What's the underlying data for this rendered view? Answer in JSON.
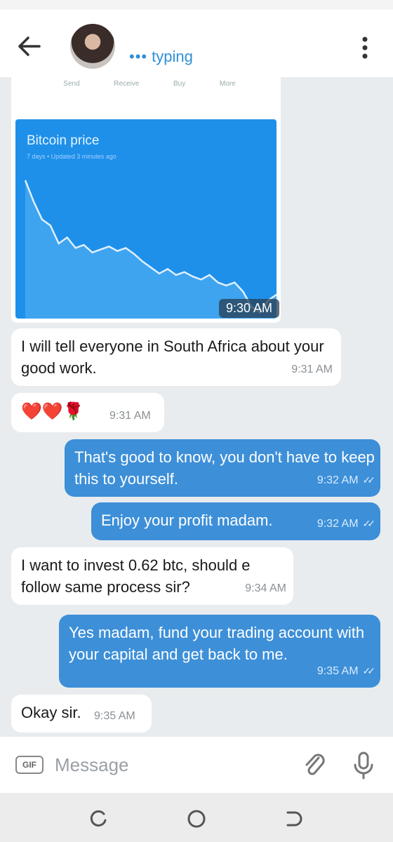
{
  "header": {
    "typing_dots": "•••",
    "status": "typing"
  },
  "image_message": {
    "tabs": [
      "Send",
      "Receive",
      "Buy",
      "More"
    ],
    "chart_title": "Bitcoin price",
    "chart_subtitle": "7 days • Updated 3 minutes ago",
    "time": "9:30 AM"
  },
  "chart_data": {
    "type": "area",
    "title": "Bitcoin price",
    "subtitle": "7 days • Updated 3 minutes ago",
    "x": [
      0,
      1,
      2,
      3,
      4,
      5,
      6,
      7,
      8,
      9,
      10,
      11,
      12,
      13,
      14,
      15,
      16,
      17,
      18,
      19,
      20,
      21,
      22,
      23,
      24,
      25,
      26,
      27,
      28,
      29,
      30
    ],
    "values": [
      92,
      78,
      66,
      62,
      50,
      54,
      47,
      49,
      44,
      46,
      48,
      45,
      47,
      43,
      38,
      34,
      30,
      33,
      29,
      31,
      28,
      26,
      29,
      24,
      22,
      24,
      18,
      8,
      4,
      12,
      16
    ],
    "grid": false
  },
  "messages": [
    {
      "dir": "in",
      "text": "I will tell everyone in South Africa about your good work.",
      "time": "9:31 AM"
    },
    {
      "dir": "in",
      "text": "❤️❤️🌹",
      "time": "9:31 AM"
    },
    {
      "dir": "out",
      "text": "That's good to know, you don't have to keep this to yourself.",
      "time": "9:32 AM"
    },
    {
      "dir": "out",
      "text": "Enjoy your profit madam.",
      "time": "9:32 AM"
    },
    {
      "dir": "in",
      "text": "I want to invest 0.62 btc, should e follow same process sir?",
      "time": "9:34 AM"
    },
    {
      "dir": "out",
      "text": "Yes madam, fund your trading account with your capital and get back to me.",
      "time": "9:35 AM"
    },
    {
      "dir": "in",
      "text": "Okay sir.",
      "time": "9:35 AM"
    }
  ],
  "input": {
    "gif_label": "GIF",
    "placeholder": "Message"
  },
  "icons": {
    "back": "arrow-left",
    "menu": "dots-vertical",
    "attach": "paperclip",
    "mic": "microphone",
    "nav_recent": "recent-apps",
    "nav_home": "home",
    "nav_back": "back"
  },
  "colors": {
    "accent": "#2f8fd8",
    "outgoing_bubble": "#3d8fd8",
    "incoming_bubble": "#ffffff",
    "chart_bg": "#1e90ea"
  }
}
